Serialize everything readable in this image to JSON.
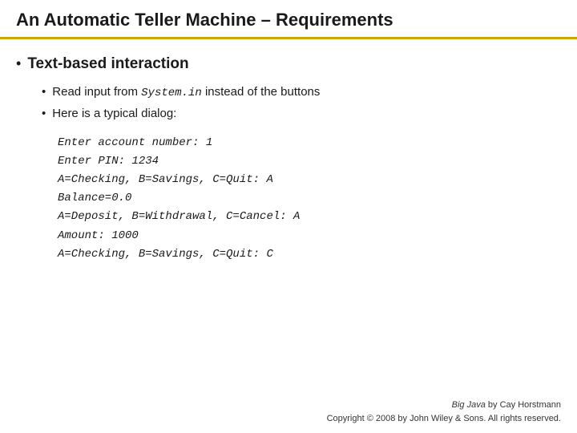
{
  "header": {
    "title": "An Automatic Teller Machine – Requirements"
  },
  "main_bullet": {
    "text": "Text-based interaction"
  },
  "sub_bullets": [
    {
      "text_plain": "Read input from ",
      "text_code": "System.in",
      "text_rest": " instead of the buttons"
    },
    {
      "text_plain": "Here is a typical dialog:"
    }
  ],
  "code_lines": [
    "Enter account number: 1",
    "Enter PIN: 1234",
    "A=Checking, B=Savings, C=Quit: A",
    "Balance=0.0",
    "A=Deposit, B=Withdrawal, C=Cancel: A",
    "Amount: 1000",
    "A=Checking, B=Savings, C=Quit: C"
  ],
  "footer": {
    "book_title": "Big Java",
    "author": "by Cay Horstmann",
    "copyright": "Copyright © 2008 by John Wiley & Sons.  All rights reserved."
  }
}
